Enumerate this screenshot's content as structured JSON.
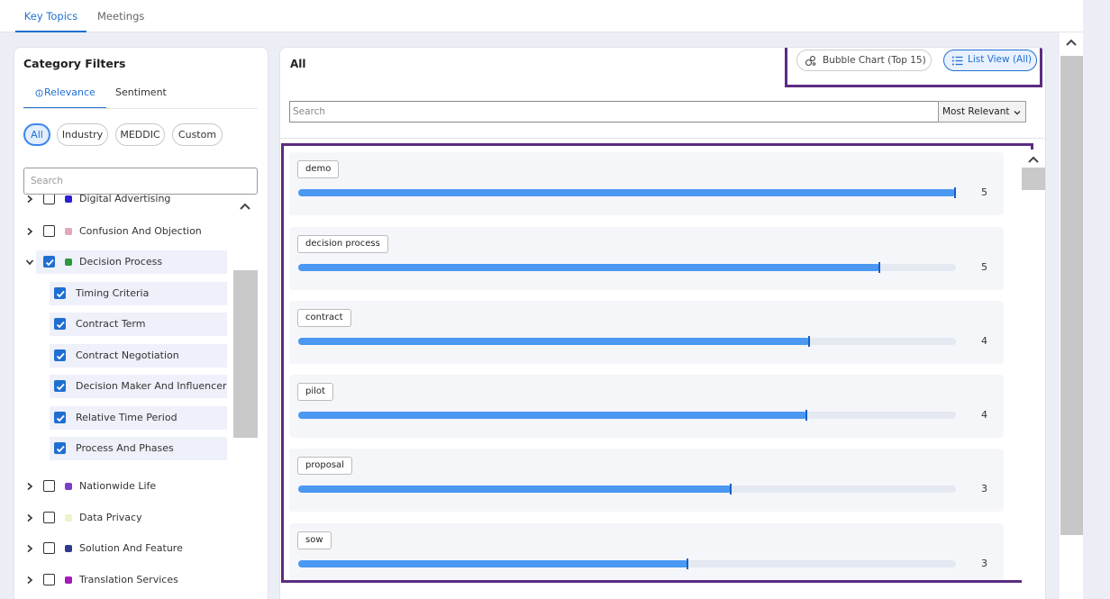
{
  "tabs": [
    {
      "label": "Key Topics",
      "active": true
    },
    {
      "label": "Meetings",
      "active": false
    }
  ],
  "category_filters": {
    "title": "Category Filters",
    "modes": [
      "Relevance",
      "Sentiment"
    ],
    "pills": [
      "All",
      "Industry",
      "MEDDIC",
      "Custom"
    ],
    "search_placeholder": "Search",
    "items": [
      {
        "label": "Digital Advertising",
        "color": "#2b1fd1",
        "checked": false
      },
      {
        "label": "Confusion And Objection",
        "color": "#e3a8b8",
        "checked": false
      },
      {
        "label": "Decision Process",
        "color": "#2a9a3c",
        "checked": true
      },
      {
        "label": "Timing Criteria",
        "checked": true
      },
      {
        "label": "Contract Term",
        "checked": true
      },
      {
        "label": "Contract Negotiation",
        "checked": true
      },
      {
        "label": "Decision Maker And Influencer",
        "checked": true
      },
      {
        "label": "Relative Time Period",
        "checked": true
      },
      {
        "label": "Process And Phases",
        "checked": true
      },
      {
        "label": "Nationwide Life",
        "color": "#7a3ec9",
        "checked": false
      },
      {
        "label": "Data Privacy",
        "color": "#eef3c8",
        "checked": false
      },
      {
        "label": "Solution And Feature",
        "color": "#33388f",
        "checked": false
      },
      {
        "label": "Translation Services",
        "color": "#a21cb5",
        "checked": false
      }
    ]
  },
  "main": {
    "title": "All",
    "views": [
      {
        "label": "Bubble Chart (Top 15)",
        "active": false
      },
      {
        "label": "List View (All)",
        "active": true
      }
    ],
    "search_placeholder": "Search",
    "sort_selected": "Most Relevant",
    "max_count": 5,
    "topics": [
      {
        "label": "demo",
        "count": 5,
        "fill_pct": 100
      },
      {
        "label": "decision process",
        "count": 5,
        "fill_pct": 88.5
      },
      {
        "label": "contract",
        "count": 4,
        "fill_pct": 77.8
      },
      {
        "label": "pilot",
        "count": 4,
        "fill_pct": 77.4
      },
      {
        "label": "proposal",
        "count": 3,
        "fill_pct": 65.9
      },
      {
        "label": "sow",
        "count": 3,
        "fill_pct": 59.3
      }
    ]
  }
}
